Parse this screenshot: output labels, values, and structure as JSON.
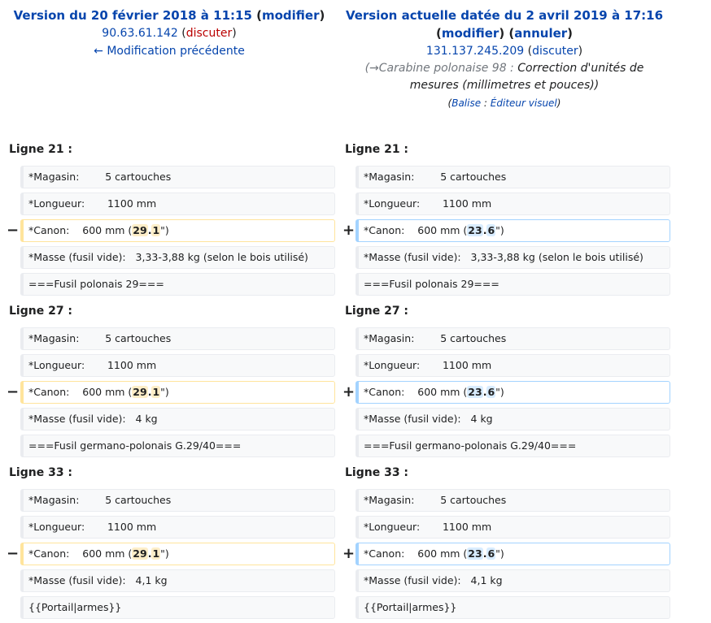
{
  "left_header": {
    "title": "Version du 20 février 2018 à 11:15",
    "open": " (",
    "modify": "modifier",
    "close": ")",
    "user": "90.63.61.142",
    "discuss": "discuter",
    "prev_link": "← Modification précédente"
  },
  "right_header": {
    "title": "Version actuelle datée du 2 avril 2019 à 17:16",
    "modify": "modifier",
    "undo": "annuler",
    "user": "131.137.245.209",
    "discuss": "discuter",
    "comment_section": "(→Carabine polonaise 98 :",
    "comment_text": "Correction d'unités de mesures (millimetres et pouces))",
    "tag_label": "Balise",
    "tag_value": "Éditeur visuel"
  },
  "markers": {
    "removed": "−",
    "added": "+"
  },
  "blocks": [
    {
      "label": "Ligne 21 :",
      "lines": [
        "*Magasin:        5 cartouches",
        "*Longueur:       1100 mm"
      ],
      "changed_prefix": "*Canon:    600 mm (",
      "old_a": "29",
      "old_dot": ".",
      "old_b": "1",
      "new_a": "23",
      "new_dot": ".",
      "new_b": "6",
      "changed_suffix": "\")",
      "after": [
        "*Masse (fusil vide):   3,33-3,88 kg (selon le bois utilisé)",
        "===Fusil polonais 29==="
      ]
    },
    {
      "label": "Ligne 27 :",
      "lines": [
        "*Magasin:        5 cartouches",
        "*Longueur:       1100 mm"
      ],
      "changed_prefix": "*Canon:    600 mm (",
      "old_a": "29",
      "old_dot": ".",
      "old_b": "1",
      "new_a": "23",
      "new_dot": ".",
      "new_b": "6",
      "changed_suffix": "\")",
      "after": [
        "*Masse (fusil vide):   4 kg",
        "===Fusil germano-polonais G.29/40==="
      ]
    },
    {
      "label": "Ligne 33 :",
      "lines": [
        "*Magasin:        5 cartouches",
        "*Longueur:       1100 mm"
      ],
      "changed_prefix": "*Canon:    600 mm (",
      "old_a": "29",
      "old_dot": ".",
      "old_b": "1",
      "new_a": "23",
      "new_dot": ".",
      "new_b": "6",
      "changed_suffix": "\")",
      "after": [
        "*Masse (fusil vide):   4,1 kg",
        "{{Portail|armes}}"
      ]
    }
  ]
}
